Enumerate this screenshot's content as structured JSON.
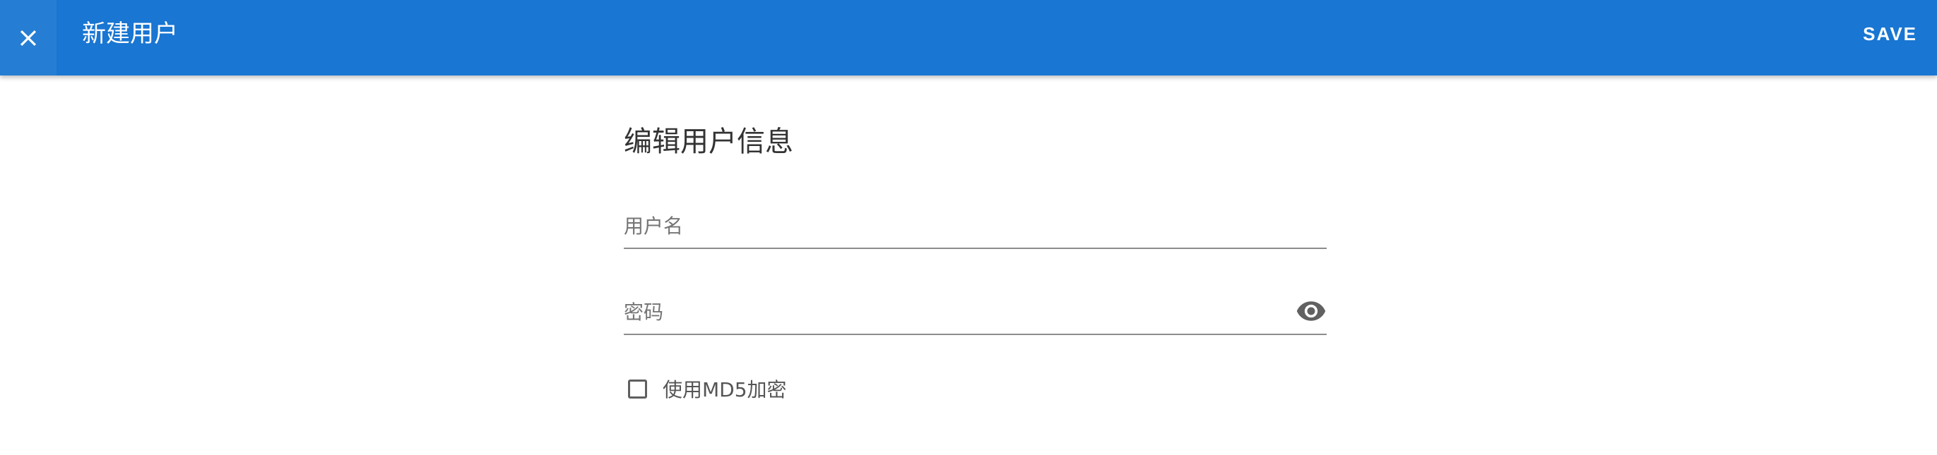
{
  "toolbar": {
    "title": "新建用户",
    "close_icon": "close-icon",
    "save_label": "SAVE",
    "background_color": "#1976d2"
  },
  "form": {
    "title": "编辑用户信息",
    "username": {
      "label": "用户名",
      "value": ""
    },
    "password": {
      "label": "密码",
      "value": "",
      "toggle_icon": "eye-icon"
    },
    "md5": {
      "label": "使用MD5加密",
      "checked": false
    }
  }
}
